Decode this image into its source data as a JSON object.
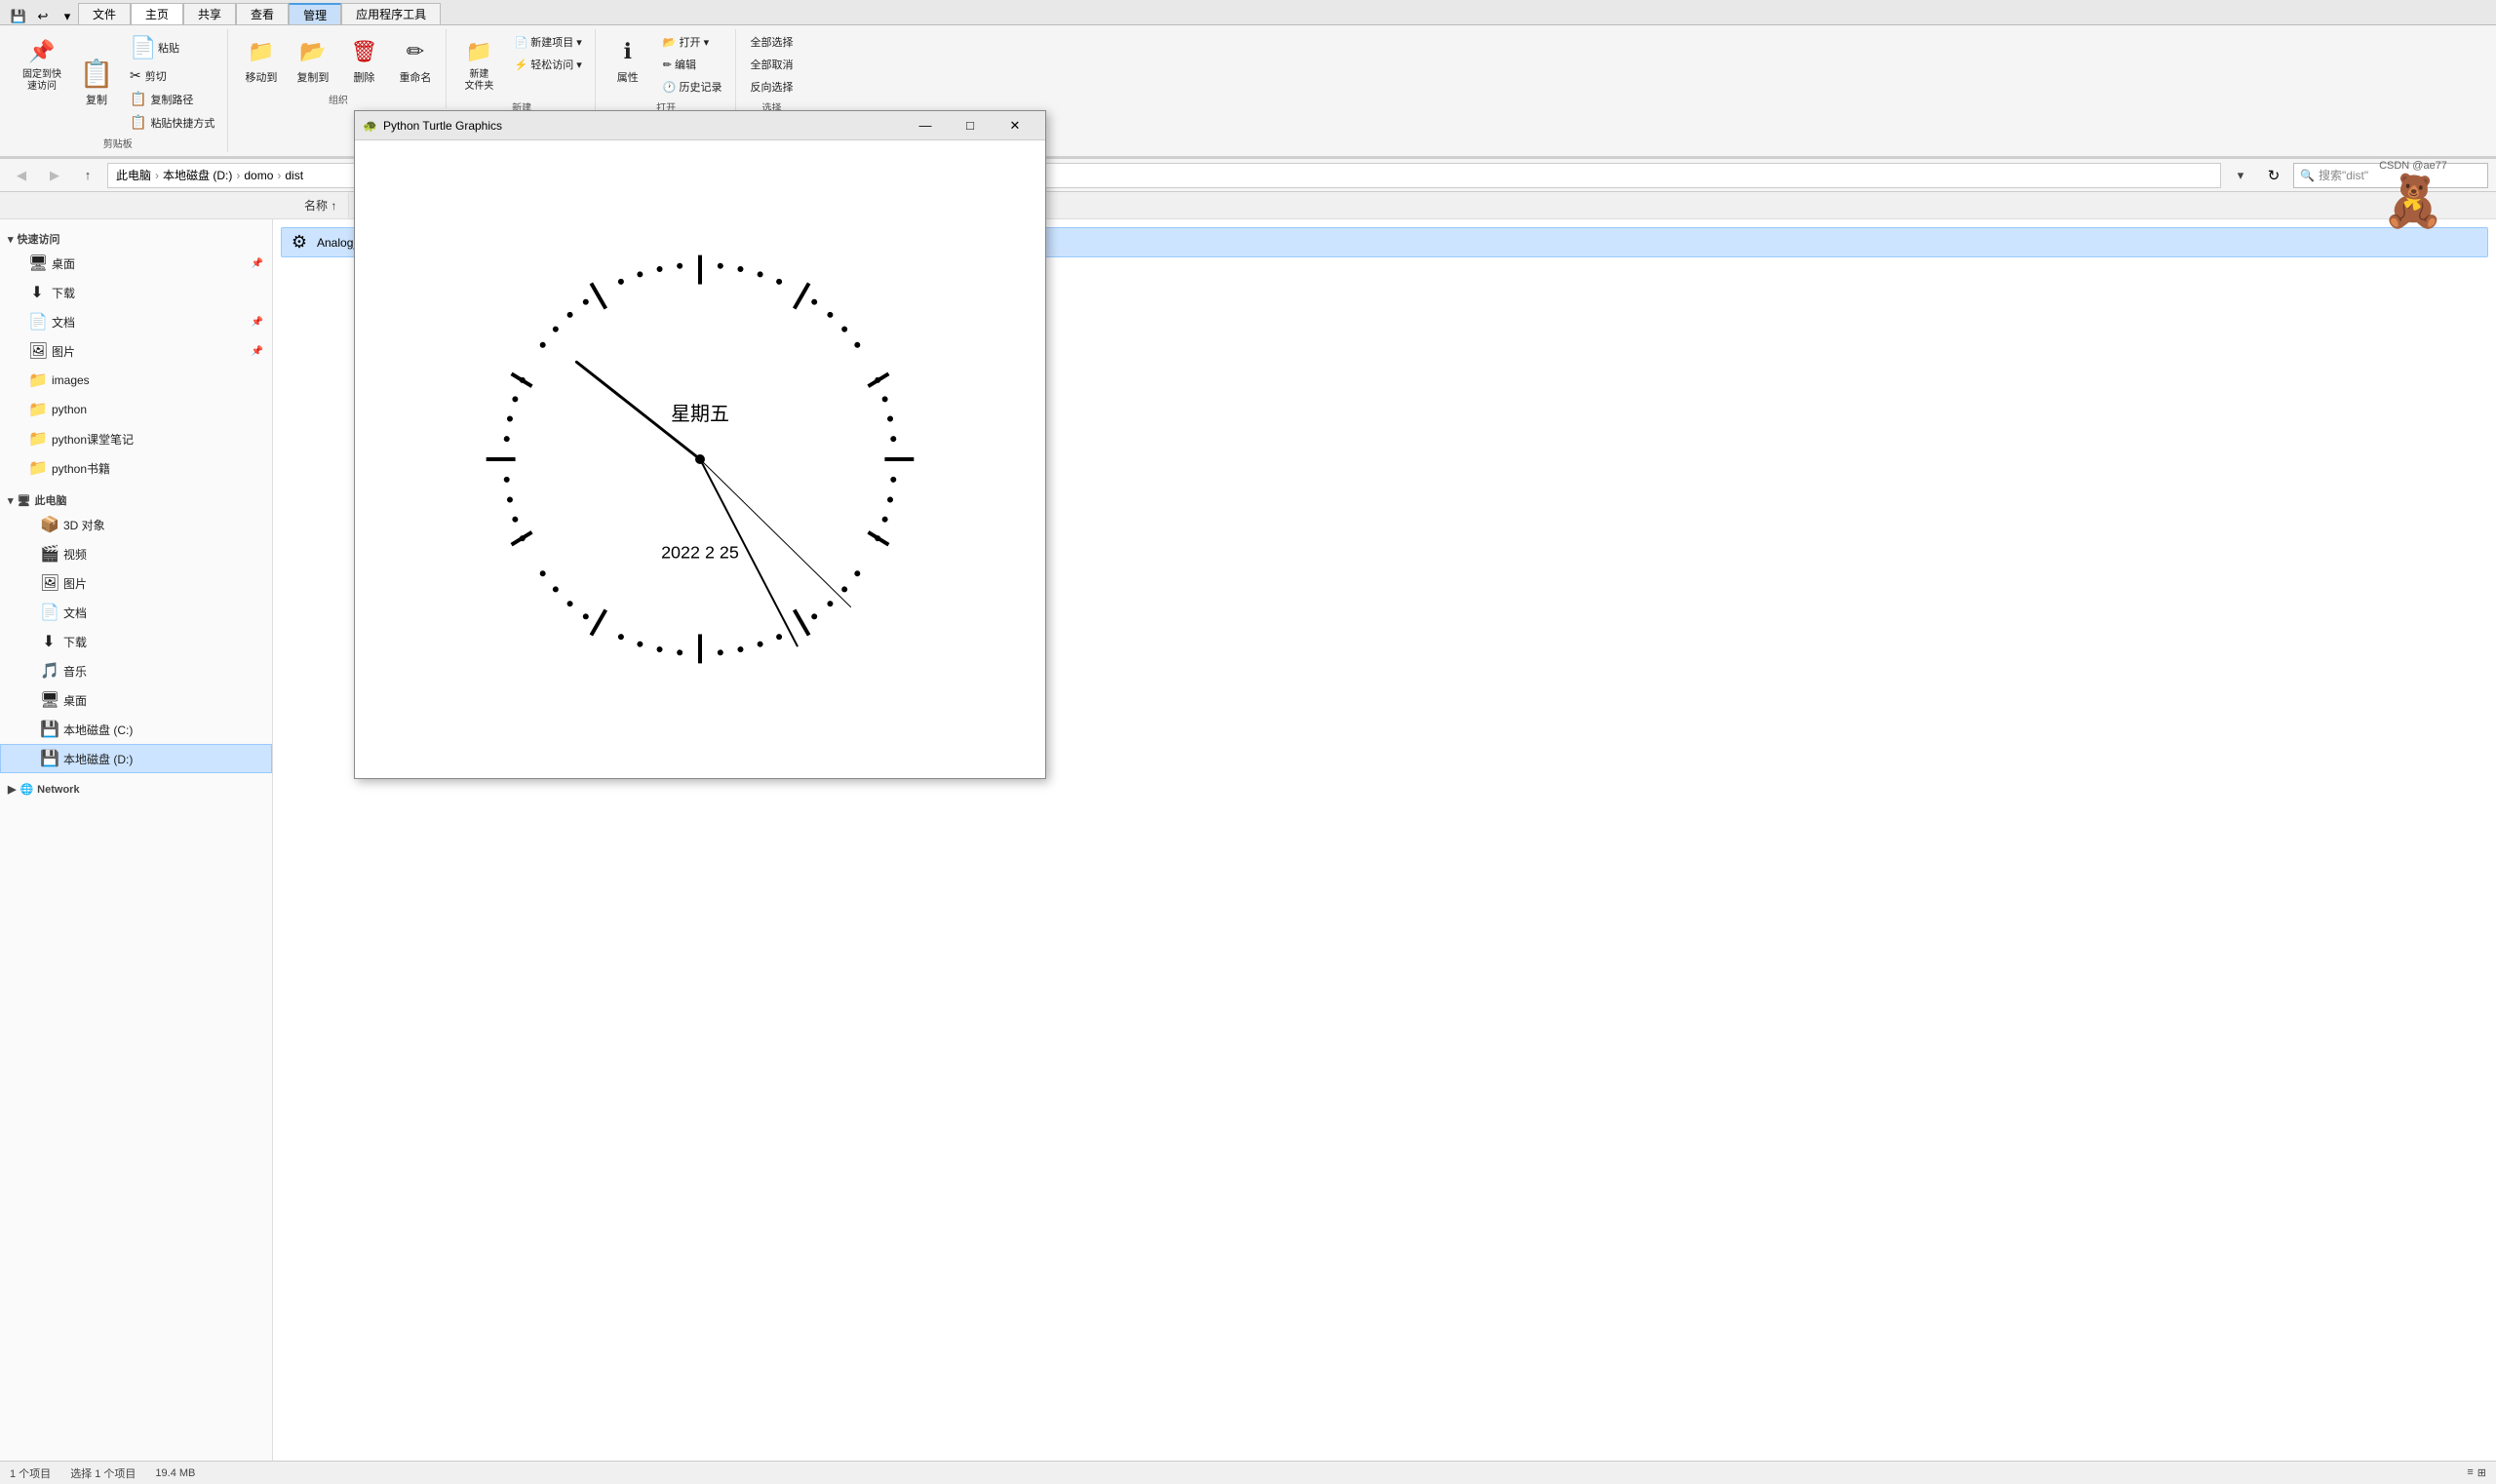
{
  "explorer": {
    "title": "dist",
    "window_controls": {
      "minimize": "—",
      "maximize": "□",
      "close": "✕"
    },
    "qat": {
      "back": "⬅",
      "forward": "➡",
      "recent": "▾"
    },
    "ribbon": {
      "tabs": [
        {
          "id": "file",
          "label": "文件",
          "active": false
        },
        {
          "id": "home",
          "label": "主页",
          "active": true
        },
        {
          "id": "share",
          "label": "共享",
          "active": false
        },
        {
          "id": "view",
          "label": "查看",
          "active": false
        },
        {
          "id": "manage",
          "label": "管理",
          "active": false,
          "highlighted": true
        },
        {
          "id": "app",
          "label": "应用程序工具",
          "active": false
        }
      ],
      "groups": {
        "clipboard": {
          "label": "剪贴板",
          "buttons": [
            {
              "id": "pin",
              "icon": "📌",
              "label": "固定到快\n速访问"
            },
            {
              "id": "copy",
              "icon": "📋",
              "label": "复制"
            },
            {
              "id": "paste",
              "icon": "📄",
              "label": "粘贴"
            }
          ],
          "small_buttons": [
            {
              "id": "cut",
              "icon": "✂",
              "label": "剪切"
            },
            {
              "id": "copy-path",
              "icon": "🔗",
              "label": "复制路径"
            },
            {
              "id": "paste-shortcut",
              "icon": "📋",
              "label": "粘贴快捷方式"
            }
          ]
        },
        "organize": {
          "label": "组织",
          "buttons": [
            {
              "id": "move",
              "icon": "➡",
              "label": "移动到"
            },
            {
              "id": "copyto",
              "icon": "📁",
              "label": "复制到"
            },
            {
              "id": "delete",
              "icon": "🗑",
              "label": "删除"
            },
            {
              "id": "rename",
              "icon": "✏",
              "label": "重命名"
            }
          ]
        },
        "new": {
          "label": "新建",
          "buttons": [
            {
              "id": "new-folder",
              "icon": "📁",
              "label": "新建\n文件夹"
            }
          ],
          "dropdown_buttons": [
            {
              "id": "new-item",
              "label": "📄 新建项目 ▾"
            },
            {
              "id": "easy-access",
              "label": "⚡ 轻松访问 ▾"
            }
          ]
        },
        "open": {
          "label": "打开",
          "buttons": [
            {
              "id": "properties",
              "icon": "ℹ",
              "label": "属性"
            }
          ],
          "dropdown_buttons": [
            {
              "id": "open",
              "label": "📂 打开 ▾"
            },
            {
              "id": "edit",
              "label": "✏ 编辑"
            },
            {
              "id": "history",
              "label": "🕐 历史记录"
            }
          ]
        },
        "select": {
          "label": "选择",
          "buttons": [
            {
              "id": "select-all",
              "label": "全部选择"
            },
            {
              "id": "select-none",
              "label": "全部取消"
            },
            {
              "id": "invert",
              "label": "反向选择"
            }
          ]
        }
      }
    },
    "address_bar": {
      "path": "此电脑 › 本地磁盘 (D:) › domo › dist",
      "path_parts": [
        "此电脑",
        "本地磁盘 (D:)",
        "domo",
        "dist"
      ],
      "search_placeholder": "搜索\"dist\""
    },
    "sidebar": {
      "quick_access_label": "快速访问",
      "items": [
        {
          "id": "desktop",
          "icon": "🖥",
          "label": "桌面",
          "pinned": true,
          "level": 1
        },
        {
          "id": "downloads",
          "icon": "⬇",
          "label": "下载",
          "pinned": false,
          "level": 1
        },
        {
          "id": "documents",
          "icon": "📄",
          "label": "文档",
          "pinned": true,
          "level": 1
        },
        {
          "id": "pictures",
          "icon": "🖼",
          "label": "图片",
          "pinned": true,
          "level": 1
        },
        {
          "id": "images",
          "icon": "📁",
          "label": "images",
          "pinned": false,
          "level": 1
        },
        {
          "id": "python",
          "icon": "📁",
          "label": "python",
          "pinned": false,
          "level": 1
        },
        {
          "id": "python-notes",
          "icon": "📁",
          "label": "python课堂笔记",
          "pinned": false,
          "level": 1
        },
        {
          "id": "python-books",
          "icon": "📁",
          "label": "python书籍",
          "pinned": false,
          "level": 1
        }
      ],
      "this_pc_label": "此电脑",
      "this_pc_items": [
        {
          "id": "3d",
          "icon": "📦",
          "label": "3D 对象",
          "level": 2
        },
        {
          "id": "video",
          "icon": "🎬",
          "label": "视频",
          "level": 2
        },
        {
          "id": "pictures2",
          "icon": "🖼",
          "label": "图片",
          "level": 2
        },
        {
          "id": "documents2",
          "icon": "📄",
          "label": "文档",
          "level": 2
        },
        {
          "id": "downloads2",
          "icon": "⬇",
          "label": "下载",
          "level": 2
        },
        {
          "id": "music",
          "icon": "🎵",
          "label": "音乐",
          "level": 2
        },
        {
          "id": "desktop2",
          "icon": "🖥",
          "label": "桌面",
          "level": 2
        },
        {
          "id": "disk-c",
          "icon": "💾",
          "label": "本地磁盘 (C:)",
          "level": 2
        },
        {
          "id": "disk-d",
          "icon": "💾",
          "label": "本地磁盘 (D:)",
          "level": 2,
          "selected": true
        }
      ],
      "network_label": "Network"
    },
    "files": {
      "items": [
        {
          "id": "analog-clock",
          "icon": "⚙",
          "label": "Analog_clock.exe",
          "selected": true
        }
      ],
      "count_label": "1 个项目",
      "selected_label": "选择 1 个项目",
      "size_label": "19.4 MB"
    }
  },
  "turtle_window": {
    "title": "Python Turtle Graphics",
    "icon": "🐢",
    "controls": {
      "minimize": "—",
      "maximize": "□",
      "close": "✕"
    },
    "clock": {
      "day_label": "星期五",
      "date_label": "2022  2  25",
      "radius": 220
    }
  },
  "taskbar": {
    "watermark": "CSDN @ae77"
  }
}
